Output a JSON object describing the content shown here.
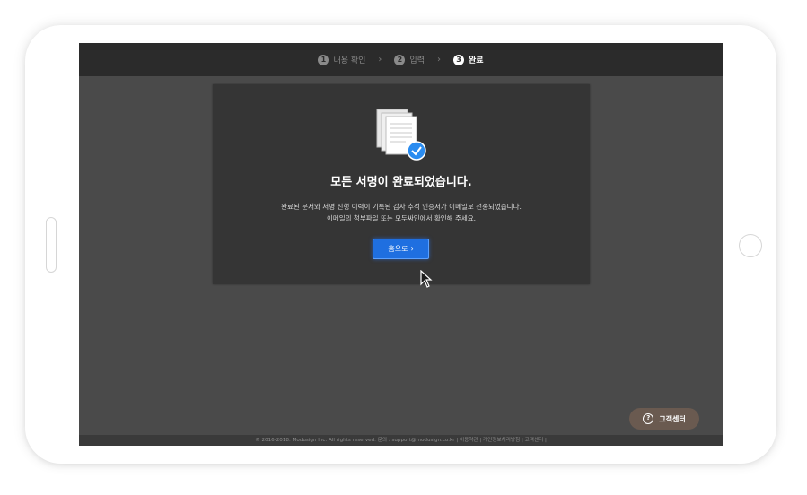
{
  "steps": [
    {
      "num": "1",
      "label": "내용 확인"
    },
    {
      "num": "2",
      "label": "입력"
    },
    {
      "num": "3",
      "label": "완료"
    }
  ],
  "step_separator": "›",
  "modal": {
    "title": "모든 서명이 완료되었습니다.",
    "description_line1": "완료된 문서와 서명 진행 이력이 기록된 감사 추적 인증서가 이메일로 전송되었습니다.",
    "description_line2": "이메일의 첨부파일 또는 모두싸인에서 확인해 주세요.",
    "home_button_label": "홈으로",
    "home_button_chevron": "›"
  },
  "help": {
    "icon_glyph": "?",
    "label": "고객센터"
  },
  "footer": "© 2016-2018. Modusign Inc. All rights reserved. 문의 : support@modusign.co.kr | 이용약관 | 개인정보처리방침 | 고객센터 |",
  "colors": {
    "accent": "#1f6fe0",
    "check_badge": "#2a8cf0",
    "help_bg": "#6a5a50"
  }
}
